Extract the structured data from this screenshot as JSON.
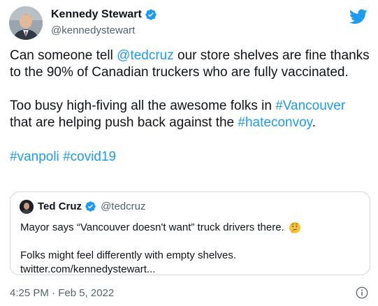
{
  "author": {
    "name": "Kennedy Stewart",
    "handle": "@kennedystewart"
  },
  "tweet": {
    "p1": [
      {
        "t": "Can someone tell ",
        "link": false
      },
      {
        "t": "@tedcruz",
        "link": true
      },
      {
        "t": " our store shelves are fine thanks to the 90% of Canadian truckers who are fully vaccinated.",
        "link": false
      }
    ],
    "p2": [
      {
        "t": "Too busy high-fiving all the awesome folks in ",
        "link": false
      },
      {
        "t": "#Vancouver",
        "link": true
      },
      {
        "t": " that are helping push back against the ",
        "link": false
      },
      {
        "t": "#hateconvoy",
        "link": true
      },
      {
        "t": ".",
        "link": false
      }
    ],
    "p3": [
      {
        "t": "#vanpoli",
        "link": true
      },
      {
        "t": " ",
        "link": false
      },
      {
        "t": "#covid19",
        "link": true
      }
    ]
  },
  "quoted": {
    "name": "Ted Cruz",
    "handle": "@tedcruz",
    "line1": "Mayor says “Vancouver doesn't  want” truck drivers there.",
    "line1_emoji": "thinking-face-icon",
    "line2": "Folks might feel differently with empty shelves.",
    "line3": "twitter.com/kennedystewart..."
  },
  "timestamp": "4:25 PM · Feb 5, 2022",
  "icons": {
    "verified": "verified-badge-icon",
    "twitter": "twitter-bird-icon",
    "info": "info-icon"
  },
  "colors": {
    "link": "#1d9bf0",
    "text": "#0f1419",
    "muted": "#536471",
    "border": "#cfd9de"
  }
}
